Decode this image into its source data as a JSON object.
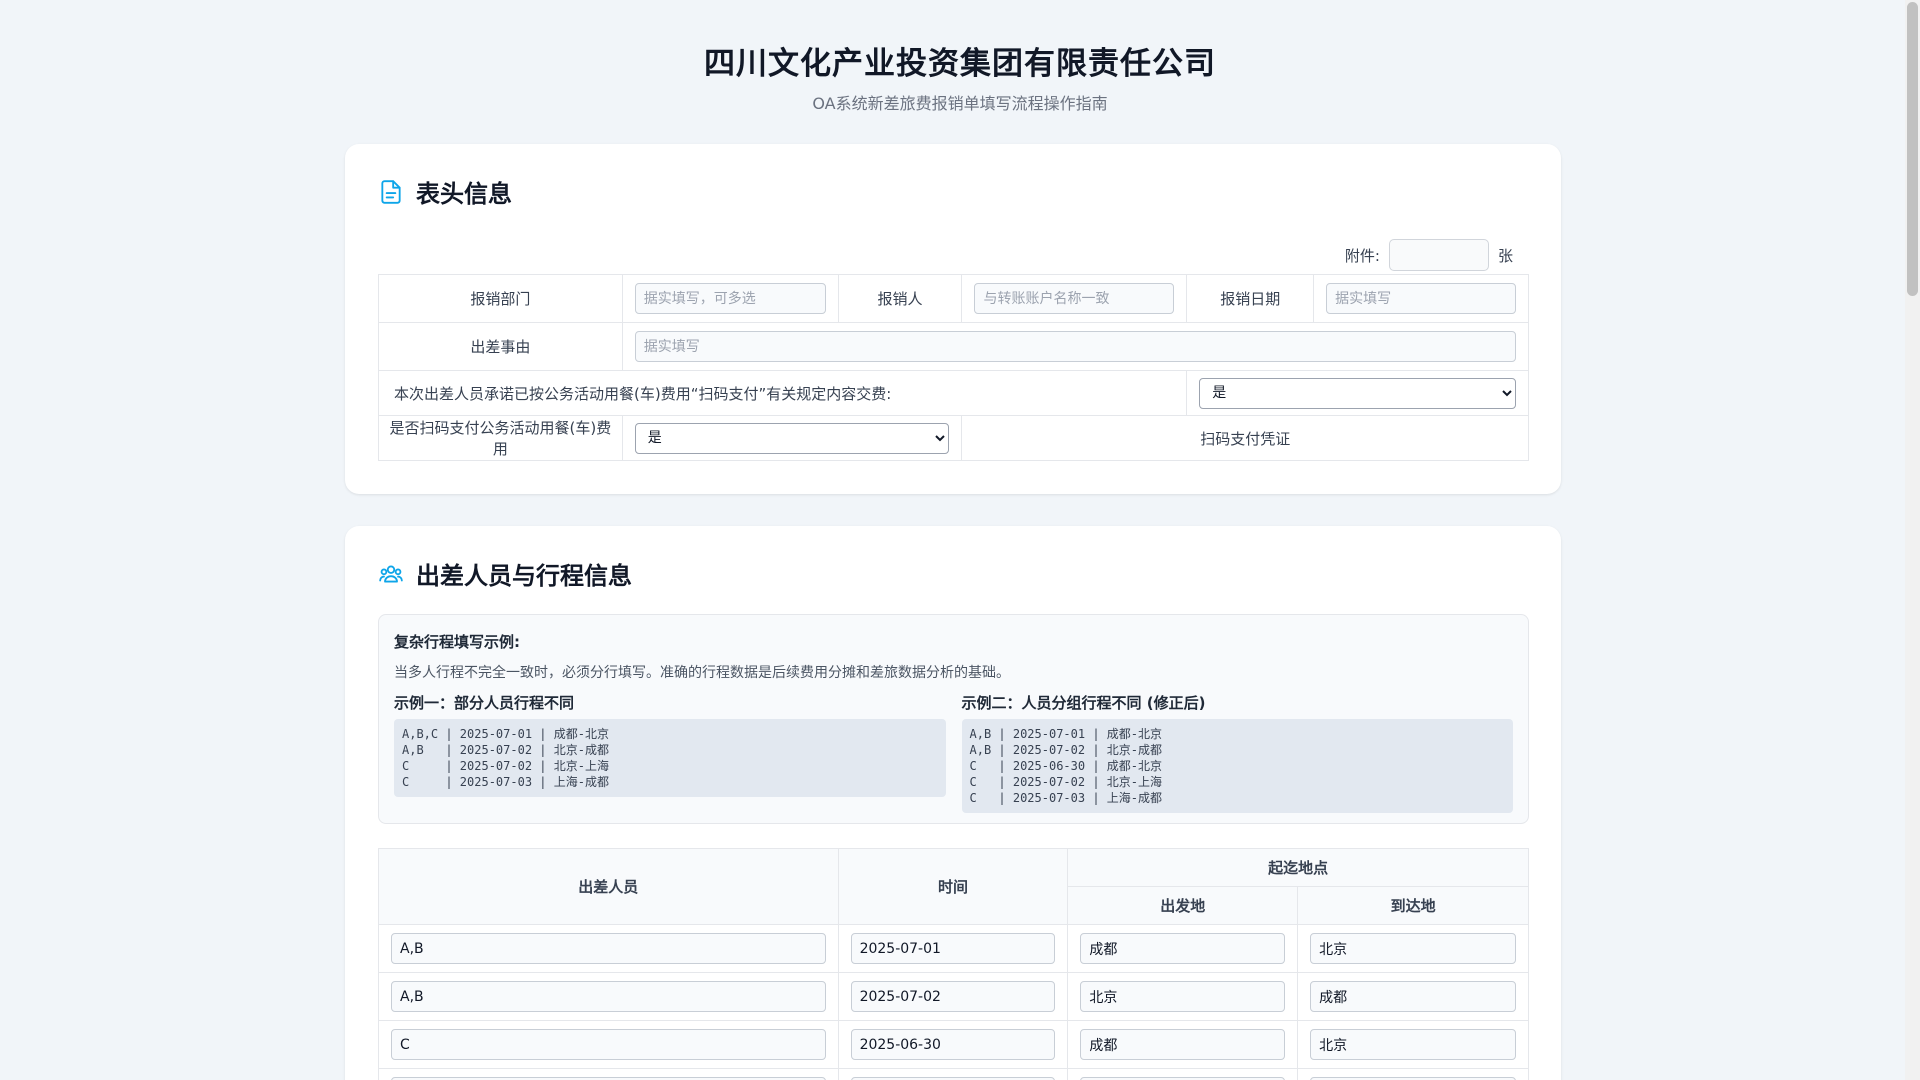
{
  "header": {
    "title": "四川文化产业投资集团有限责任公司",
    "subtitle": "OA系统新差旅费报销单填写流程操作指南"
  },
  "section1": {
    "title": "表头信息",
    "icon": "document-icon",
    "attachment_label": "附件:",
    "attachment_unit": "张",
    "dept_label": "报销部门",
    "dept_placeholder": "据实填写，可多选",
    "claimant_label": "报销人",
    "claimant_placeholder": "与转账账户名称一致",
    "date_label": "报销日期",
    "date_placeholder": "据实填写",
    "reason_label": "出差事由",
    "reason_placeholder": "据实填写",
    "pledge_text": "本次出差人员承诺已按公务活动用餐(车)费用“扫码支付”有关规定内容交费:",
    "pledge_value": "是",
    "scan_label": "是否扫码支付公务活动用餐(车)费用",
    "scan_value": "是",
    "voucher_label": "扫码支付凭证"
  },
  "section2": {
    "title": "出差人员与行程信息",
    "icon": "users-icon",
    "example_title": "复杂行程填写示例:",
    "example_desc": "当多人行程不完全一致时，必须分行填写。准确的行程数据是后续费用分摊和差旅数据分析的基础。",
    "example1_title": "示例一：部分人员行程不同",
    "example1_code": "A,B,C | 2025-07-01 | 成都-北京\nA,B   | 2025-07-02 | 北京-成都\nC     | 2025-07-02 | 北京-上海\nC     | 2025-07-03 | 上海-成都",
    "example2_title": "示例二：人员分组行程不同 (修正后)",
    "example2_code": "A,B | 2025-07-01 | 成都-北京\nA,B | 2025-07-02 | 北京-成都\nC   | 2025-06-30 | 成都-北京\nC   | 2025-07-02 | 北京-上海\nC   | 2025-07-03 | 上海-成都",
    "table": {
      "col_people": "出差人员",
      "col_time": "时间",
      "col_route": "起迄地点",
      "col_from": "出发地",
      "col_to": "到达地",
      "rows": [
        {
          "people": "A,B",
          "date": "2025-07-01",
          "from": "成都",
          "to": "北京"
        },
        {
          "people": "A,B",
          "date": "2025-07-02",
          "from": "北京",
          "to": "成都"
        },
        {
          "people": "C",
          "date": "2025-06-30",
          "from": "成都",
          "to": "北京"
        }
      ]
    }
  }
}
